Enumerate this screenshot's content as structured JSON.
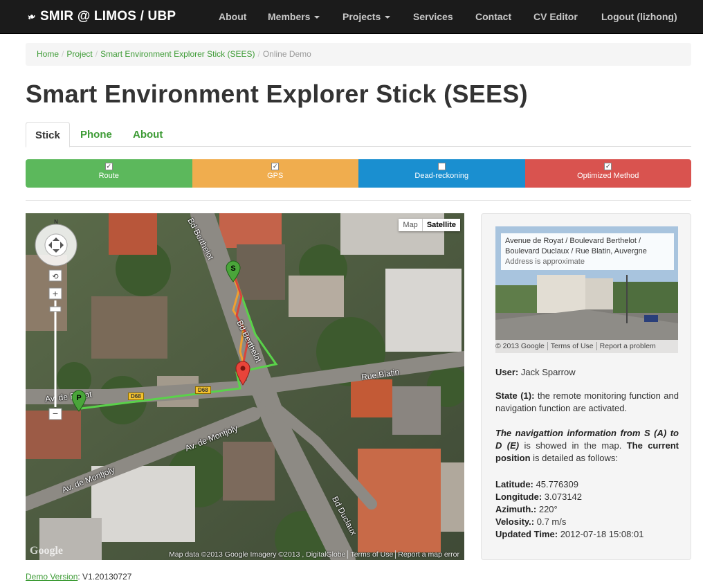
{
  "navbar": {
    "brand": "SMIR @ LIMOS / UBP",
    "items": [
      {
        "label": "About",
        "dropdown": false
      },
      {
        "label": "Members",
        "dropdown": true
      },
      {
        "label": "Projects",
        "dropdown": true
      },
      {
        "label": "Services",
        "dropdown": false
      },
      {
        "label": "Contact",
        "dropdown": false
      },
      {
        "label": "CV Editor",
        "dropdown": false
      },
      {
        "label": "Logout (lizhong)",
        "dropdown": false
      }
    ]
  },
  "breadcrumb": [
    "Home",
    "Project",
    "Smart Environment Explorer Stick (SEES)",
    "Online Demo"
  ],
  "page_title": "Smart Environment Explorer Stick (SEES)",
  "tabs": [
    {
      "label": "Stick",
      "active": true
    },
    {
      "label": "Phone",
      "active": false
    },
    {
      "label": "About",
      "active": false
    }
  ],
  "toggles": [
    {
      "label": "Route",
      "checked": true,
      "color": "#5cb85c"
    },
    {
      "label": "GPS",
      "checked": true,
      "color": "#f0ad4e"
    },
    {
      "label": "Dead-reckoning",
      "checked": false,
      "color": "#1a8fd0"
    },
    {
      "label": "Optimized Method",
      "checked": true,
      "color": "#d9534f"
    }
  ],
  "map": {
    "type_buttons": [
      "Map",
      "Satellite"
    ],
    "attribution": [
      "Map data ©2013 Google Imagery ©2013 , DigitalGlobe",
      "Terms of Use",
      "Report a map error"
    ],
    "logo": "Google",
    "street_labels": [
      "Bd Berthelot",
      "Bd Berthelot",
      "Rue Blatin",
      "Av. de Royat",
      "Av. de Montjoly",
      "Av. de Montjoly",
      "Bd Duclaux"
    ],
    "road_shield": "D68",
    "start_marker": "S",
    "position_marker": "P"
  },
  "streetview": {
    "address_line1": "Avenue de Royat / Boulevard Berthelot /",
    "address_line2": "Boulevard Duclaux / Rue Blatin, Auvergne",
    "approx": "Address is approximate",
    "footer": [
      "© 2013 Google",
      "Terms of Use",
      "Report a problem"
    ]
  },
  "info": {
    "user_label": "User:",
    "user_value": "Jack Sparrow",
    "state_label": "State (1):",
    "state_text": "the remote monitoring function and navigation function are activated.",
    "nav_label": "The navigattion information from S (A) to D (E)",
    "nav_text": "is showed in the map.",
    "current_label": "The current position",
    "current_text": "is detailed as follows:",
    "fields": [
      {
        "label": "Latitude:",
        "value": "45.776309"
      },
      {
        "label": "Longitude:",
        "value": "3.073142"
      },
      {
        "label": "Azimuth.:",
        "value": "220°"
      },
      {
        "label": "Velosity.:",
        "value": "0.7 m/s"
      },
      {
        "label": "Updated Time:",
        "value": "2012-07-18 15:08:01"
      }
    ]
  },
  "footer": {
    "link": "Demo Version",
    "version": ": V1.20130727"
  }
}
